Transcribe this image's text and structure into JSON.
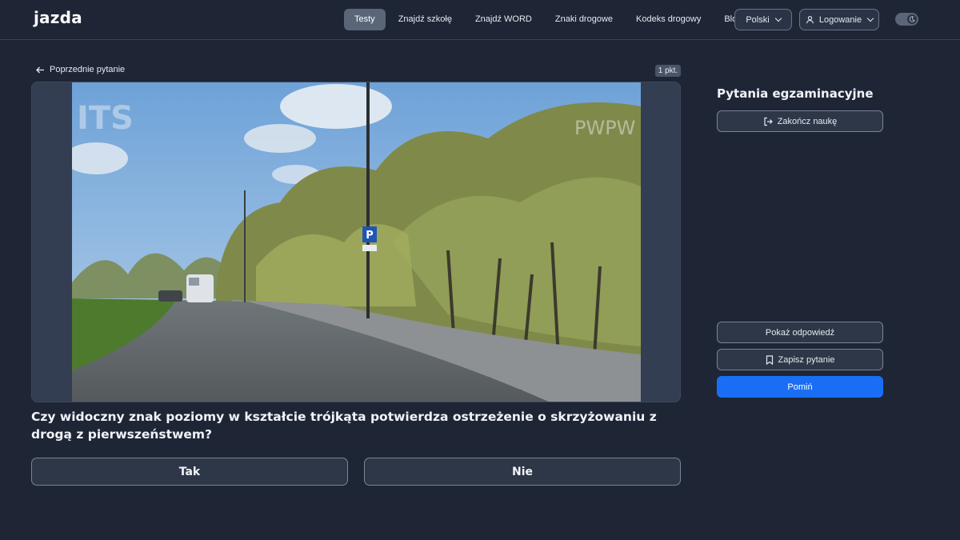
{
  "header": {
    "logo_text": "jazda",
    "nav": [
      {
        "label": "Testy",
        "active": true
      },
      {
        "label": "Znajdź szkołę",
        "active": false
      },
      {
        "label": "Znajdź WORD",
        "active": false
      },
      {
        "label": "Znaki drogowe",
        "active": false
      },
      {
        "label": "Kodeks drogowy",
        "active": false
      },
      {
        "label": "Blog",
        "active": false
      }
    ],
    "language_label": "Polski",
    "login_label": "Logowanie",
    "theme_toggle_icon": "moon-icon"
  },
  "main": {
    "prev_question_label": "Poprzednie pytanie",
    "points_badge": "1 pkt.",
    "media": {
      "watermark_left": "ITS",
      "watermark_right": "PWPW",
      "parking_sign": "P"
    },
    "question": "Czy widoczny znak poziomy w kształcie trójkąta potwierdza ostrzeżenie o skrzyżowaniu z drogą z pierwszeństwem?",
    "answers": [
      "Tak",
      "Nie"
    ]
  },
  "sidebar": {
    "title": "Pytania egzaminacyjne",
    "end_label": "Zakończ naukę",
    "show_answer_label": "Pokaż odpowiedź",
    "save_question_label": "Zapisz pytanie",
    "skip_label": "Pomiń",
    "accent_color": "#1a6ef5"
  }
}
